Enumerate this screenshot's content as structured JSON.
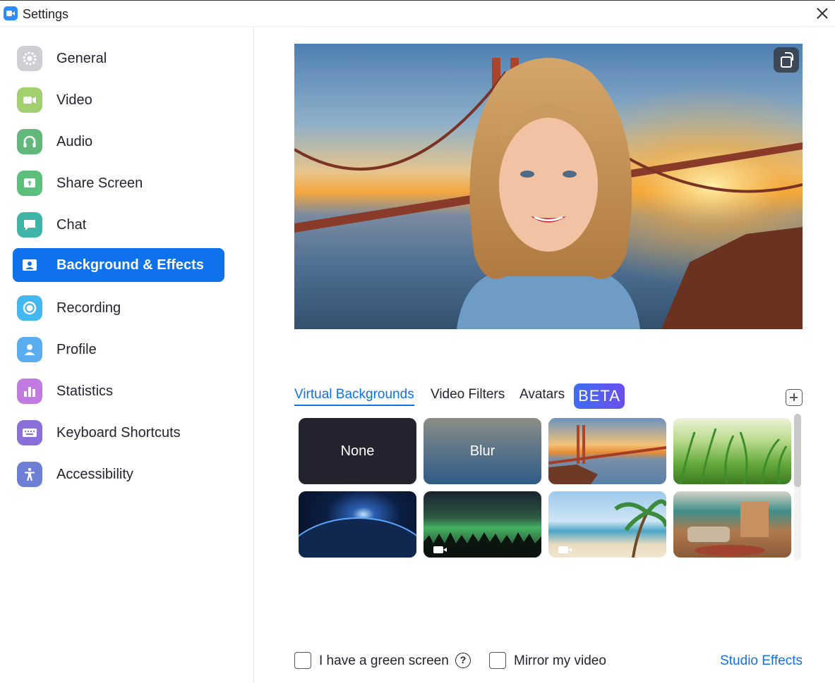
{
  "window": {
    "title": "Settings",
    "app_icon": "zoom-camera-icon",
    "close_icon": "close-icon"
  },
  "sidebar": {
    "items": [
      {
        "label": "General",
        "icon": "gear-icon",
        "color": "#c5c5c9",
        "active": false
      },
      {
        "label": "Video",
        "icon": "video-camera-icon",
        "color": "#a3d06f",
        "active": false
      },
      {
        "label": "Audio",
        "icon": "headphones-icon",
        "color": "#61b87a",
        "active": false
      },
      {
        "label": "Share Screen",
        "icon": "share-screen-icon",
        "color": "#5cc07c",
        "active": false
      },
      {
        "label": "Chat",
        "icon": "chat-bubble-icon",
        "color": "#3fb4a8",
        "active": false
      },
      {
        "label": "Background & Effects",
        "icon": "background-effects-icon",
        "color": "#ffffff",
        "active": true
      },
      {
        "label": "Recording",
        "icon": "recording-icon",
        "color": "#43b7f0",
        "active": false
      },
      {
        "label": "Profile",
        "icon": "profile-icon",
        "color": "#5aaef0",
        "active": false
      },
      {
        "label": "Statistics",
        "icon": "statistics-icon",
        "color": "#c17be0",
        "active": false
      },
      {
        "label": "Keyboard Shortcuts",
        "icon": "keyboard-icon",
        "color": "#8a6fd8",
        "active": false
      },
      {
        "label": "Accessibility",
        "icon": "accessibility-icon",
        "color": "#6d7fd4",
        "active": false
      }
    ],
    "active_color": "#0e72ed"
  },
  "preview": {
    "rotate_icon": "rotate-camera-icon"
  },
  "tabs": {
    "items": [
      "Virtual Backgrounds",
      "Video Filters",
      "Avatars"
    ],
    "active": "Virtual Backgrounds",
    "beta_label": "BETA",
    "add_icon": "add-background-icon"
  },
  "backgrounds": {
    "none_label": "None",
    "blur_label": "Blur",
    "thumbnails": [
      {
        "name": "golden-gate",
        "video": false
      },
      {
        "name": "grass",
        "video": false
      },
      {
        "name": "earth",
        "video": false
      },
      {
        "name": "aurora",
        "video": true
      },
      {
        "name": "beach",
        "video": true
      },
      {
        "name": "living-room",
        "video": false
      }
    ]
  },
  "bottom": {
    "green_screen_label": "I have a green screen",
    "green_screen_checked": false,
    "help_icon": "question-circle-icon",
    "help_glyph": "?",
    "mirror_label": "Mirror my video",
    "mirror_checked": false,
    "studio_effects_label": "Studio Effects"
  }
}
